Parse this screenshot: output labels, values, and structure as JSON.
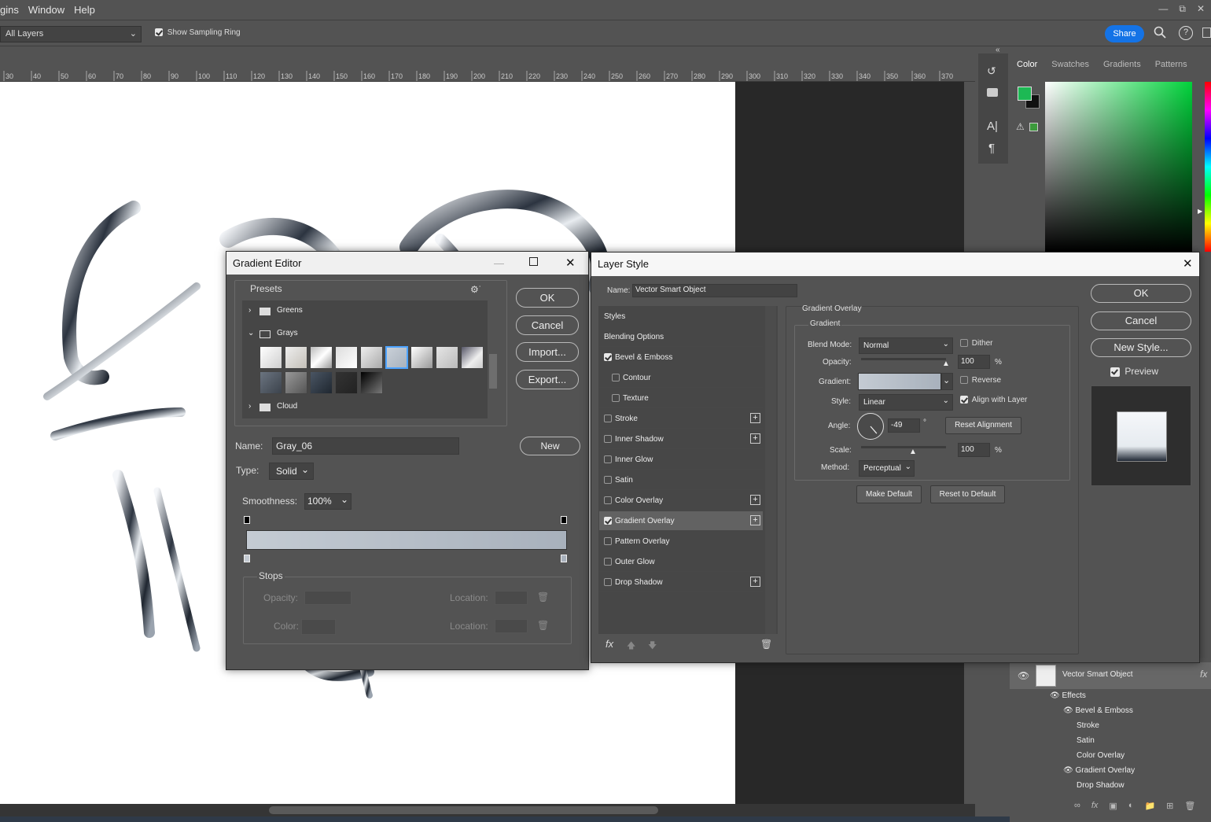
{
  "menubar": {
    "items": [
      "gins",
      "Window",
      "Help"
    ]
  },
  "options_bar": {
    "sample": "All Layers",
    "sampling_ring_label": "Show Sampling Ring",
    "share": "Share"
  },
  "ruler": {
    "ticks": [
      "30",
      "40",
      "50",
      "60",
      "70",
      "80",
      "90",
      "100",
      "110",
      "120",
      "130",
      "140",
      "150",
      "160",
      "170",
      "180",
      "190",
      "200",
      "210",
      "220",
      "230",
      "240",
      "250",
      "260",
      "270",
      "280",
      "290",
      "300",
      "310",
      "320",
      "330",
      "340",
      "350",
      "360",
      "370"
    ]
  },
  "color_panel": {
    "tabs": [
      "Color",
      "Swatches",
      "Gradients",
      "Patterns"
    ],
    "foreground": "#1db954"
  },
  "gradient_editor": {
    "title": "Gradient Editor",
    "presets_label": "Presets",
    "folders": [
      "Greens",
      "Grays",
      "Cloud"
    ],
    "buttons": {
      "ok": "OK",
      "cancel": "Cancel",
      "import": "Import...",
      "export": "Export...",
      "new": "New"
    },
    "name_label": "Name:",
    "name_value": "Gray_06",
    "type_label": "Type:",
    "type_value": "Solid",
    "smoothness_label": "Smoothness:",
    "smoothness_value": "100%",
    "stops_label": "Stops",
    "opacity_label": "Opacity:",
    "color_label": "Color:",
    "location_label": "Location:",
    "location2_label": "Location:"
  },
  "layer_style": {
    "title": "Layer Style",
    "name_label": "Name:",
    "name_value": "Vector Smart Object",
    "styles": [
      {
        "label": "Styles",
        "type": "header"
      },
      {
        "label": "Blending Options",
        "type": "header"
      },
      {
        "label": "Bevel & Emboss",
        "checked": true,
        "plus": false,
        "indent": false
      },
      {
        "label": "Contour",
        "checked": false,
        "plus": false,
        "indent": true
      },
      {
        "label": "Texture",
        "checked": false,
        "plus": false,
        "indent": true
      },
      {
        "label": "Stroke",
        "checked": false,
        "plus": true,
        "indent": false
      },
      {
        "label": "Inner Shadow",
        "checked": false,
        "plus": true,
        "indent": false
      },
      {
        "label": "Inner Glow",
        "checked": false,
        "plus": false,
        "indent": false
      },
      {
        "label": "Satin",
        "checked": false,
        "plus": false,
        "indent": false
      },
      {
        "label": "Color Overlay",
        "checked": false,
        "plus": true,
        "indent": false
      },
      {
        "label": "Gradient Overlay",
        "checked": true,
        "plus": true,
        "indent": false,
        "selected": true
      },
      {
        "label": "Pattern Overlay",
        "checked": false,
        "plus": false,
        "indent": false
      },
      {
        "label": "Outer Glow",
        "checked": false,
        "plus": false,
        "indent": false
      },
      {
        "label": "Drop Shadow",
        "checked": false,
        "plus": true,
        "indent": false
      }
    ],
    "section_title": "Gradient Overlay",
    "subsection_title": "Gradient",
    "blend_mode_label": "Blend Mode:",
    "blend_mode_value": "Normal",
    "dither_label": "Dither",
    "opacity_label": "Opacity:",
    "opacity_value": "100",
    "percent": "%",
    "gradient_label": "Gradient:",
    "reverse_label": "Reverse",
    "style_label": "Style:",
    "style_value": "Linear",
    "align_label": "Align with Layer",
    "angle_label": "Angle:",
    "angle_value": "-49",
    "degree": "°",
    "reset_alignment": "Reset Alignment",
    "scale_label": "Scale:",
    "scale_value": "100",
    "method_label": "Method:",
    "method_value": "Perceptual",
    "make_default": "Make Default",
    "reset_default": "Reset to Default",
    "ok": "OK",
    "cancel": "Cancel",
    "new_style": "New Style...",
    "preview_label": "Preview",
    "fx": "fx"
  },
  "layers_panel": {
    "layer_name": "Vector Smart Object",
    "fx": "fx",
    "effects_label": "Effects",
    "effects": [
      "Bevel & Emboss",
      "Stroke",
      "Satin",
      "Color Overlay",
      "Gradient Overlay",
      "Drop Shadow"
    ]
  }
}
